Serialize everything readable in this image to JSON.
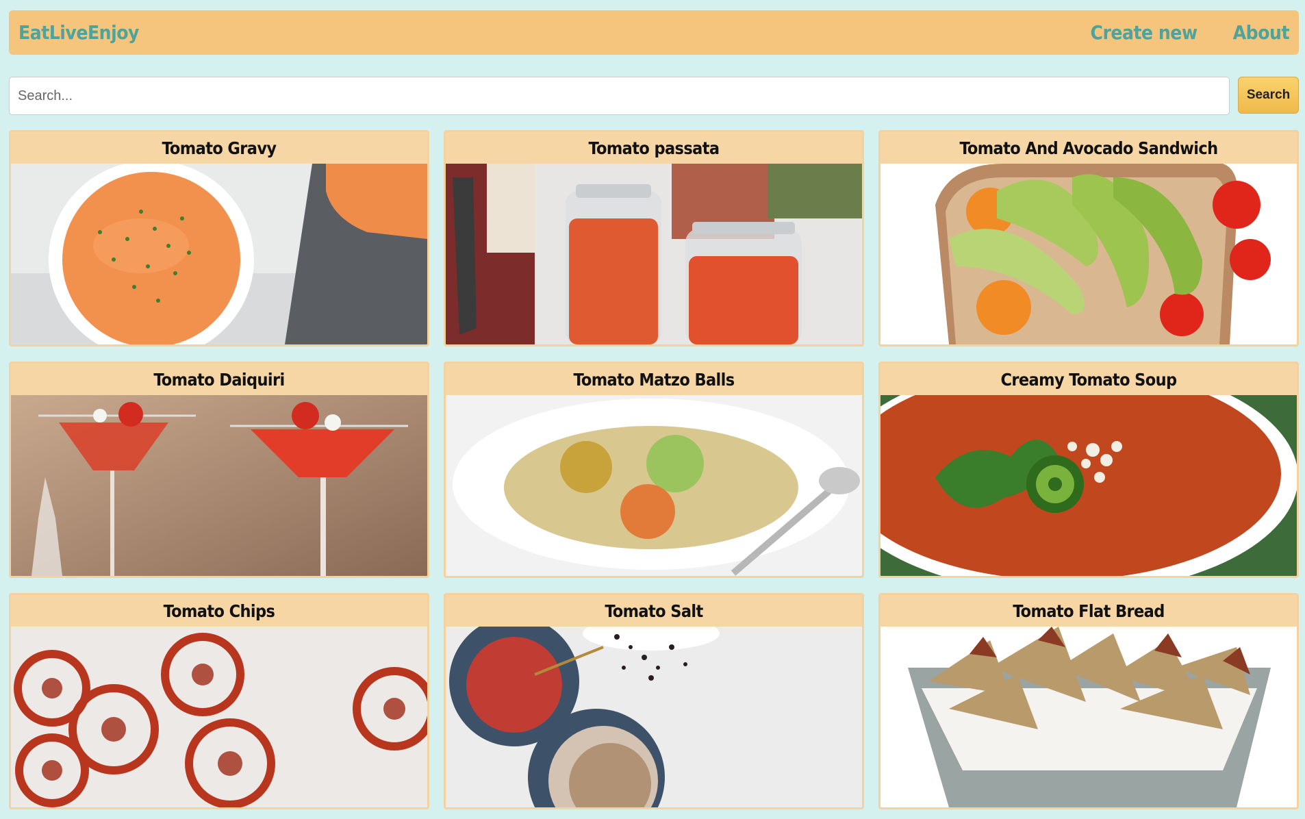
{
  "navbar": {
    "brand": "EatLiveEnjoy",
    "links": [
      "Create new",
      "About"
    ],
    "accent_color": "#4fa39b",
    "background_color": "#f6c57d"
  },
  "search": {
    "placeholder": "Search...",
    "value": "",
    "button_label": "Search"
  },
  "recipes": [
    {
      "title": "Tomato Gravy",
      "image": "bowl of orange tomato gravy with parsley"
    },
    {
      "title": "Tomato passata",
      "image": "glass jars of red tomato passata"
    },
    {
      "title": "Tomato And Avocado Sandwich",
      "image": "toast topped with avocado slices and tomatoes"
    },
    {
      "title": "Tomato Daiquiri",
      "image": "red cocktails garnished with cherry tomatoes"
    },
    {
      "title": "Tomato Matzo Balls",
      "image": "matzo ball soup in white bowl"
    },
    {
      "title": "Creamy Tomato Soup",
      "image": "tomato soup with cilantro and jalapeno"
    },
    {
      "title": "Tomato Chips",
      "image": "dried red tomato slice chips"
    },
    {
      "title": "Tomato Salt",
      "image": "bowls of tomato salt and spice"
    },
    {
      "title": "Tomato Flat Bread",
      "image": "flat bread crackers in a bowl"
    }
  ]
}
